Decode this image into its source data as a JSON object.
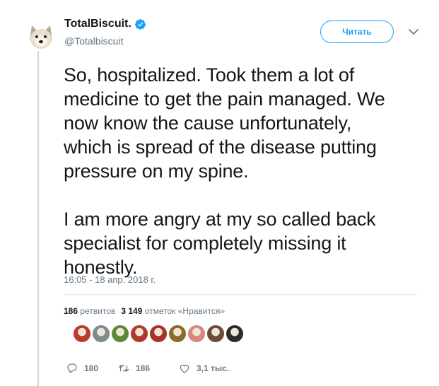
{
  "author": {
    "display_name": "TotalBiscuit.",
    "handle": "@Totalbiscuit",
    "verified": true
  },
  "follow_button": {
    "label": "Читать"
  },
  "tweet": {
    "text": "So, hospitalized. Took them a lot of\nmedicine to get the pain managed. We\nnow know the cause unfortunately,\nwhich is spread of the disease putting\npressure on my spine.\n\nI am more angry at my so called back\nspecialist for completely missing it\nhonestly.",
    "timestamp": "16:05 - 18 апр. 2018 г."
  },
  "stats": {
    "retweets_count": "186",
    "retweets_label": "ретвитов",
    "likes_count": "3 149",
    "likes_label": "отметок «Нравится»"
  },
  "likers": [
    {
      "name": "liker-1",
      "color": "#c0392b"
    },
    {
      "name": "liker-2",
      "color": "#7f8c8d"
    },
    {
      "name": "liker-3",
      "color": "#5d8a3a"
    },
    {
      "name": "liker-4",
      "color": "#b03a2e"
    },
    {
      "name": "liker-5",
      "color": "#a93226"
    },
    {
      "name": "liker-6",
      "color": "#8e6b2e"
    },
    {
      "name": "liker-7",
      "color": "#d98880"
    },
    {
      "name": "liker-8",
      "color": "#6e4b3a"
    },
    {
      "name": "liker-9",
      "color": "#2c2c2c"
    }
  ],
  "actions": {
    "reply_count": "180",
    "retweet_count": "186",
    "like_count": "3,1 тыс."
  },
  "colors": {
    "accent": "#1da1f2",
    "secondary_text": "#657786",
    "thread_line": "#ccd6dd"
  }
}
